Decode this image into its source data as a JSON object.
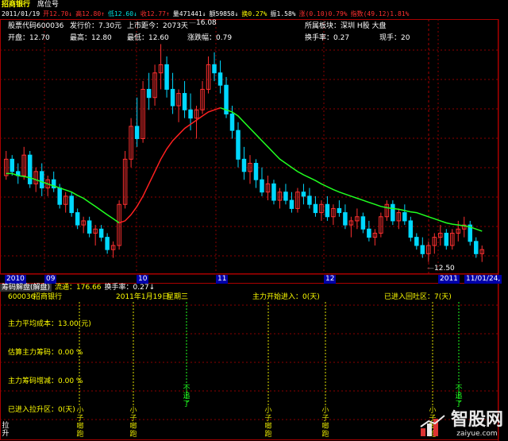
{
  "header": {
    "title": "招商银行",
    "seat": "席位号",
    "quote_line": [
      {
        "text": "2011/01/19",
        "color": "#ffffff"
      },
      {
        "text": "开12.70↓",
        "color": "#ff3030"
      },
      {
        "text": "高12.80↑",
        "color": "#ff3030"
      },
      {
        "text": "低12.60↓",
        "color": "#00e0e0"
      },
      {
        "text": "收12.77↑",
        "color": "#ff3030"
      },
      {
        "text": "量471441↓",
        "color": "#ffffff"
      },
      {
        "text": "额59858↓",
        "color": "#ffffff"
      },
      {
        "text": "换0.27%",
        "color": "#ffff00"
      },
      {
        "text": "振1.58%",
        "color": "#ffffff"
      },
      {
        "text": "涨(0.10)0.79%",
        "color": "#ff3030"
      },
      {
        "text": "指数(49.12)1.81%",
        "color": "#ff3030"
      }
    ]
  },
  "info_panel": {
    "row1": [
      {
        "label": "股票代码",
        "value": "600036"
      },
      {
        "label": "发行价：",
        "value": "7.30元"
      },
      {
        "label": "上市距今：",
        "value": "2073天"
      },
      {
        "label": "所属板块：",
        "value": "深圳 H股 大盘"
      }
    ],
    "row2": [
      {
        "label": "开盘：",
        "value": "12.70"
      },
      {
        "label": "最高：",
        "value": "12.80"
      },
      {
        "label": "最低：",
        "value": "12.60"
      },
      {
        "label": "涨跌幅：",
        "value": "0.79"
      },
      {
        "label": "换手率：",
        "value": "0.27"
      },
      {
        "label": "现手：",
        "value": "20"
      }
    ],
    "high_marker": "16.08",
    "low_marker": "12.50"
  },
  "date_axis": {
    "labels": [
      "2010",
      "09",
      "10",
      "11",
      "12",
      "2011"
    ],
    "current_date": "11/01/24,"
  },
  "sub_panel": {
    "title_tabs": [
      {
        "text": "筹码解盘(解盘)",
        "color": "#ffffff"
      },
      {
        "text": "流通：176.66",
        "color": "#ffff00"
      },
      {
        "text": "换手率：0.27↓",
        "color": "#ffffff"
      }
    ],
    "code": "600036",
    "name": "招商银行",
    "date": "2011年1月19日",
    "weekday": "星期三",
    "main_entry": "主力开始进入：0(天)",
    "entered_range": "已进入回吐区：7(天)",
    "lines": [
      "主力平均成本：13.00(元)",
      "估算主力筹码：0.00 %",
      "主力筹码增减：0.00 %",
      "已进入拉升区：0(天)"
    ],
    "signals": [
      "小",
      "子",
      "啷",
      "跑"
    ],
    "signal_alt": [
      "不",
      "追",
      "了"
    ],
    "left_corner": [
      "拉",
      "升"
    ]
  },
  "watermark": {
    "site": "智股网",
    "url": "zaiyue.com"
  },
  "colors": {
    "up": "#ff3030",
    "down": "#00d8ff",
    "ma_red": "#ff2020",
    "ma_green": "#20ff20",
    "grid": "#8b0000",
    "signal": "#e0e000"
  },
  "chart_data": {
    "type": "candlestick",
    "ma_break_index": 19,
    "candles": [
      [
        12.9,
        13.5,
        12.8,
        13.3
      ],
      [
        13.3,
        13.4,
        12.9,
        13.0
      ],
      [
        13.0,
        13.2,
        12.7,
        12.9
      ],
      [
        12.9,
        13.6,
        12.8,
        13.4
      ],
      [
        13.4,
        13.5,
        12.6,
        12.7
      ],
      [
        12.7,
        13.1,
        12.5,
        13.0
      ],
      [
        13.0,
        13.2,
        12.4,
        12.6
      ],
      [
        12.6,
        12.9,
        12.4,
        12.8
      ],
      [
        12.8,
        13.0,
        12.5,
        12.6
      ],
      [
        12.6,
        12.7,
        12.1,
        12.2
      ],
      [
        12.2,
        12.5,
        12.0,
        12.4
      ],
      [
        12.4,
        12.5,
        11.9,
        12.0
      ],
      [
        12.0,
        12.1,
        11.6,
        11.7
      ],
      [
        11.7,
        11.9,
        11.5,
        11.8
      ],
      [
        11.8,
        11.9,
        11.4,
        11.5
      ],
      [
        11.5,
        11.7,
        11.2,
        11.6
      ],
      [
        11.6,
        11.7,
        11.3,
        11.4
      ],
      [
        11.4,
        11.5,
        11.0,
        11.1
      ],
      [
        11.1,
        11.3,
        10.9,
        11.2
      ],
      [
        11.2,
        12.3,
        11.1,
        12.2
      ],
      [
        12.2,
        13.5,
        12.1,
        13.3
      ],
      [
        13.3,
        14.3,
        13.1,
        14.1
      ],
      [
        14.1,
        14.8,
        13.6,
        13.8
      ],
      [
        13.8,
        15.2,
        13.7,
        15.0
      ],
      [
        15.0,
        15.4,
        14.5,
        14.8
      ],
      [
        14.8,
        15.6,
        14.6,
        15.4
      ],
      [
        15.4,
        16.1,
        15.0,
        15.6
      ],
      [
        15.6,
        15.8,
        14.8,
        15.0
      ],
      [
        15.0,
        15.4,
        14.4,
        14.6
      ],
      [
        14.6,
        15.0,
        14.2,
        14.9
      ],
      [
        14.9,
        15.2,
        14.3,
        14.5
      ],
      [
        14.5,
        14.9,
        14.0,
        14.3
      ],
      [
        14.3,
        14.6,
        13.8,
        14.5
      ],
      [
        14.5,
        15.2,
        14.4,
        15.0
      ],
      [
        15.0,
        15.8,
        14.9,
        15.6
      ],
      [
        15.6,
        15.9,
        15.2,
        15.4
      ],
      [
        15.4,
        15.7,
        14.9,
        15.1
      ],
      [
        15.1,
        15.3,
        14.3,
        14.4
      ],
      [
        14.4,
        14.6,
        13.8,
        14.0
      ],
      [
        14.0,
        14.2,
        13.1,
        13.3
      ],
      [
        13.3,
        13.6,
        12.8,
        13.0
      ],
      [
        13.0,
        13.4,
        12.7,
        13.2
      ],
      [
        13.2,
        13.3,
        12.6,
        12.8
      ],
      [
        12.8,
        13.1,
        12.4,
        12.5
      ],
      [
        12.5,
        12.9,
        12.3,
        12.7
      ],
      [
        12.7,
        12.8,
        12.2,
        12.3
      ],
      [
        12.3,
        12.6,
        12.1,
        12.5
      ],
      [
        12.5,
        12.7,
        12.2,
        12.3
      ],
      [
        12.3,
        12.5,
        12.0,
        12.1
      ],
      [
        12.1,
        12.6,
        12.0,
        12.5
      ],
      [
        12.5,
        12.7,
        12.2,
        12.4
      ],
      [
        12.4,
        12.6,
        12.1,
        12.2
      ],
      [
        12.2,
        12.4,
        11.9,
        12.0
      ],
      [
        12.0,
        12.3,
        11.8,
        12.2
      ],
      [
        12.2,
        12.4,
        11.8,
        11.9
      ],
      [
        11.9,
        12.2,
        11.7,
        12.1
      ],
      [
        12.1,
        12.3,
        11.9,
        12.0
      ],
      [
        12.0,
        12.2,
        11.6,
        11.7
      ],
      [
        11.7,
        11.9,
        11.4,
        11.8
      ],
      [
        11.8,
        12.1,
        11.6,
        11.9
      ],
      [
        11.9,
        12.0,
        11.5,
        11.6
      ],
      [
        11.6,
        11.8,
        11.3,
        11.4
      ],
      [
        11.4,
        11.6,
        11.2,
        11.5
      ],
      [
        11.5,
        12.0,
        11.4,
        11.9
      ],
      [
        11.9,
        12.3,
        11.8,
        12.2
      ],
      [
        12.2,
        12.3,
        11.7,
        11.8
      ],
      [
        11.8,
        12.1,
        11.6,
        12.0
      ],
      [
        12.0,
        12.2,
        11.7,
        11.8
      ],
      [
        11.8,
        11.9,
        11.3,
        11.4
      ],
      [
        11.4,
        11.5,
        11.1,
        11.2
      ],
      [
        11.2,
        11.4,
        10.9,
        11.0
      ],
      [
        11.0,
        11.3,
        10.8,
        11.2
      ],
      [
        11.2,
        11.5,
        11.0,
        11.4
      ],
      [
        11.4,
        11.7,
        11.2,
        11.5
      ],
      [
        11.5,
        11.6,
        11.1,
        11.2
      ],
      [
        11.2,
        11.6,
        11.1,
        11.5
      ],
      [
        11.5,
        11.8,
        11.3,
        11.6
      ],
      [
        11.6,
        11.9,
        11.4,
        11.7
      ],
      [
        11.7,
        11.8,
        11.2,
        11.3
      ],
      [
        11.3,
        11.4,
        10.9,
        11.0
      ],
      [
        11.0,
        11.2,
        10.8,
        11.1
      ]
    ],
    "ma": [
      12.95,
      12.95,
      12.9,
      12.88,
      12.85,
      12.8,
      12.75,
      12.7,
      12.65,
      12.6,
      12.55,
      12.5,
      12.42,
      12.35,
      12.25,
      12.15,
      12.05,
      11.95,
      11.85,
      11.75,
      11.8,
      11.95,
      12.15,
      12.4,
      12.7,
      13.0,
      13.3,
      13.55,
      13.75,
      13.9,
      14.05,
      14.15,
      14.25,
      14.35,
      14.45,
      14.5,
      14.55,
      14.5,
      14.45,
      14.35,
      14.2,
      14.05,
      13.9,
      13.75,
      13.6,
      13.45,
      13.3,
      13.2,
      13.1,
      13.0,
      12.92,
      12.85,
      12.78,
      12.7,
      12.63,
      12.56,
      12.5,
      12.45,
      12.4,
      12.35,
      12.3,
      12.25,
      12.2,
      12.15,
      12.12,
      12.1,
      12.08,
      12.05,
      12.02,
      12.0,
      11.95,
      11.9,
      11.85,
      11.8,
      11.75,
      11.72,
      11.7,
      11.68,
      11.65,
      11.6,
      11.55
    ],
    "y_min": 10.6,
    "y_max": 16.4
  }
}
